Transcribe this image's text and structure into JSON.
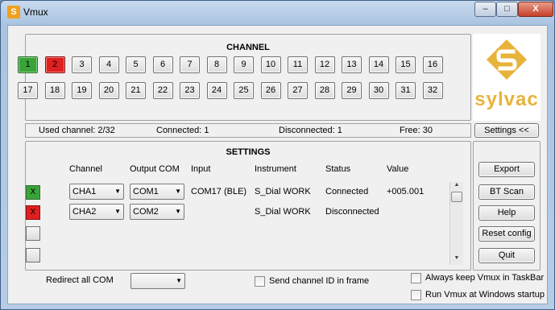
{
  "window": {
    "title": "Vmux",
    "app_icon": "S",
    "minimize": "–",
    "maximize": "□",
    "close": "X"
  },
  "channel": {
    "title": "CHANNEL",
    "row1": [
      "1",
      "2",
      "3",
      "4",
      "5",
      "6",
      "7",
      "8",
      "9",
      "10",
      "11",
      "12",
      "13",
      "14",
      "15",
      "16"
    ],
    "row2": [
      "17",
      "18",
      "19",
      "20",
      "21",
      "22",
      "23",
      "24",
      "25",
      "26",
      "27",
      "28",
      "29",
      "30",
      "31",
      "32"
    ]
  },
  "status": {
    "used": "Used channel: 2/32",
    "connected": "Connected: 1",
    "disconnected": "Disconnected: 1",
    "free": "Free: 30"
  },
  "logo": {
    "text": "sylvac"
  },
  "side_buttons": {
    "settings": "Settings <<",
    "export": "Export",
    "bt_scan": "BT Scan",
    "help": "Help",
    "reset": "Reset config",
    "quit": "Quit"
  },
  "settings": {
    "title": "SETTINGS",
    "headers": {
      "channel": "Channel",
      "output_com": "Output COM",
      "input": "Input",
      "instrument": "Instrument",
      "status": "Status",
      "value": "Value"
    },
    "rows": [
      {
        "mark": "X",
        "channel": "CHA1",
        "output_com": "COM1",
        "input": "COM17 (BLE)",
        "instrument": "S_Dial WORK",
        "status": "Connected",
        "value": "+005.001"
      },
      {
        "mark": "X",
        "channel": "CHA2",
        "output_com": "COM2",
        "input": "",
        "instrument": "S_Dial WORK",
        "status": "Disconnected",
        "value": ""
      }
    ],
    "scroll_up": "▲",
    "scroll_down": "▼"
  },
  "bottom": {
    "redirect_label": "Redirect all COM",
    "redirect_value": "",
    "send_id": "Send channel ID in frame",
    "always_keep": "Always keep Vmux in TaskBar",
    "run_startup": "Run Vmux at Windows startup",
    "dropdown_arrow": "▼"
  },
  "colors": {
    "active_green": "#3aa43a",
    "active_red": "#e02020",
    "logo_gold": "#e8b33b"
  }
}
